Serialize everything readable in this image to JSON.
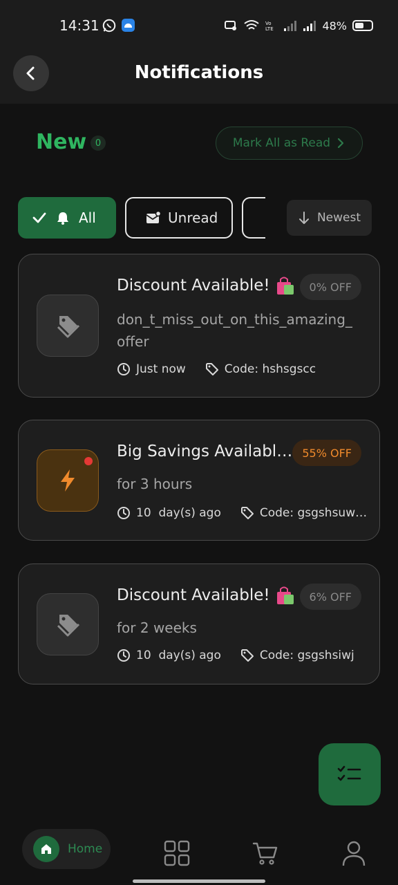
{
  "status_bar": {
    "time": "14:31",
    "battery": "48%",
    "icons": [
      "whatsapp-icon",
      "app-notification-icon",
      "cast-icon",
      "wifi-icon",
      "volte-icon",
      "signal-icon",
      "signal-icon",
      "battery-icon"
    ]
  },
  "header": {
    "title": "Notifications",
    "back_icon": "back-arrow-icon"
  },
  "summary": {
    "new_label": "New",
    "new_count": "0",
    "mark_all_label": "Mark All as Read"
  },
  "filters": {
    "all_label": "All",
    "unread_label": "Unread",
    "sort_label": "Newest"
  },
  "notifications": [
    {
      "title": "Discount Available!",
      "badge": "0% OFF",
      "description": "don_t_miss_out_on_this_amazing_offer",
      "time": "Just now",
      "code": "Code: hshsgscc",
      "icon": "tag-icon",
      "unread": false
    },
    {
      "title": "Big Savings Available...",
      "badge": "55% OFF",
      "description": "for 3 hours",
      "time": "10  day(s) ago",
      "code": "Code: gsgshsuwl...",
      "icon": "lightning-icon",
      "unread": true
    },
    {
      "title": "Discount Available!",
      "badge": "6% OFF",
      "description": "for 2 weeks",
      "time": "10  day(s) ago",
      "code": "Code: gsgshsiwj",
      "icon": "tag-icon",
      "unread": false
    }
  ],
  "bottom_nav": {
    "home_label": "Home"
  },
  "colors": {
    "accent_green": "#1f6b3d",
    "new_green": "#2fb560",
    "orange": "#f08a2c",
    "background": "#121212"
  }
}
